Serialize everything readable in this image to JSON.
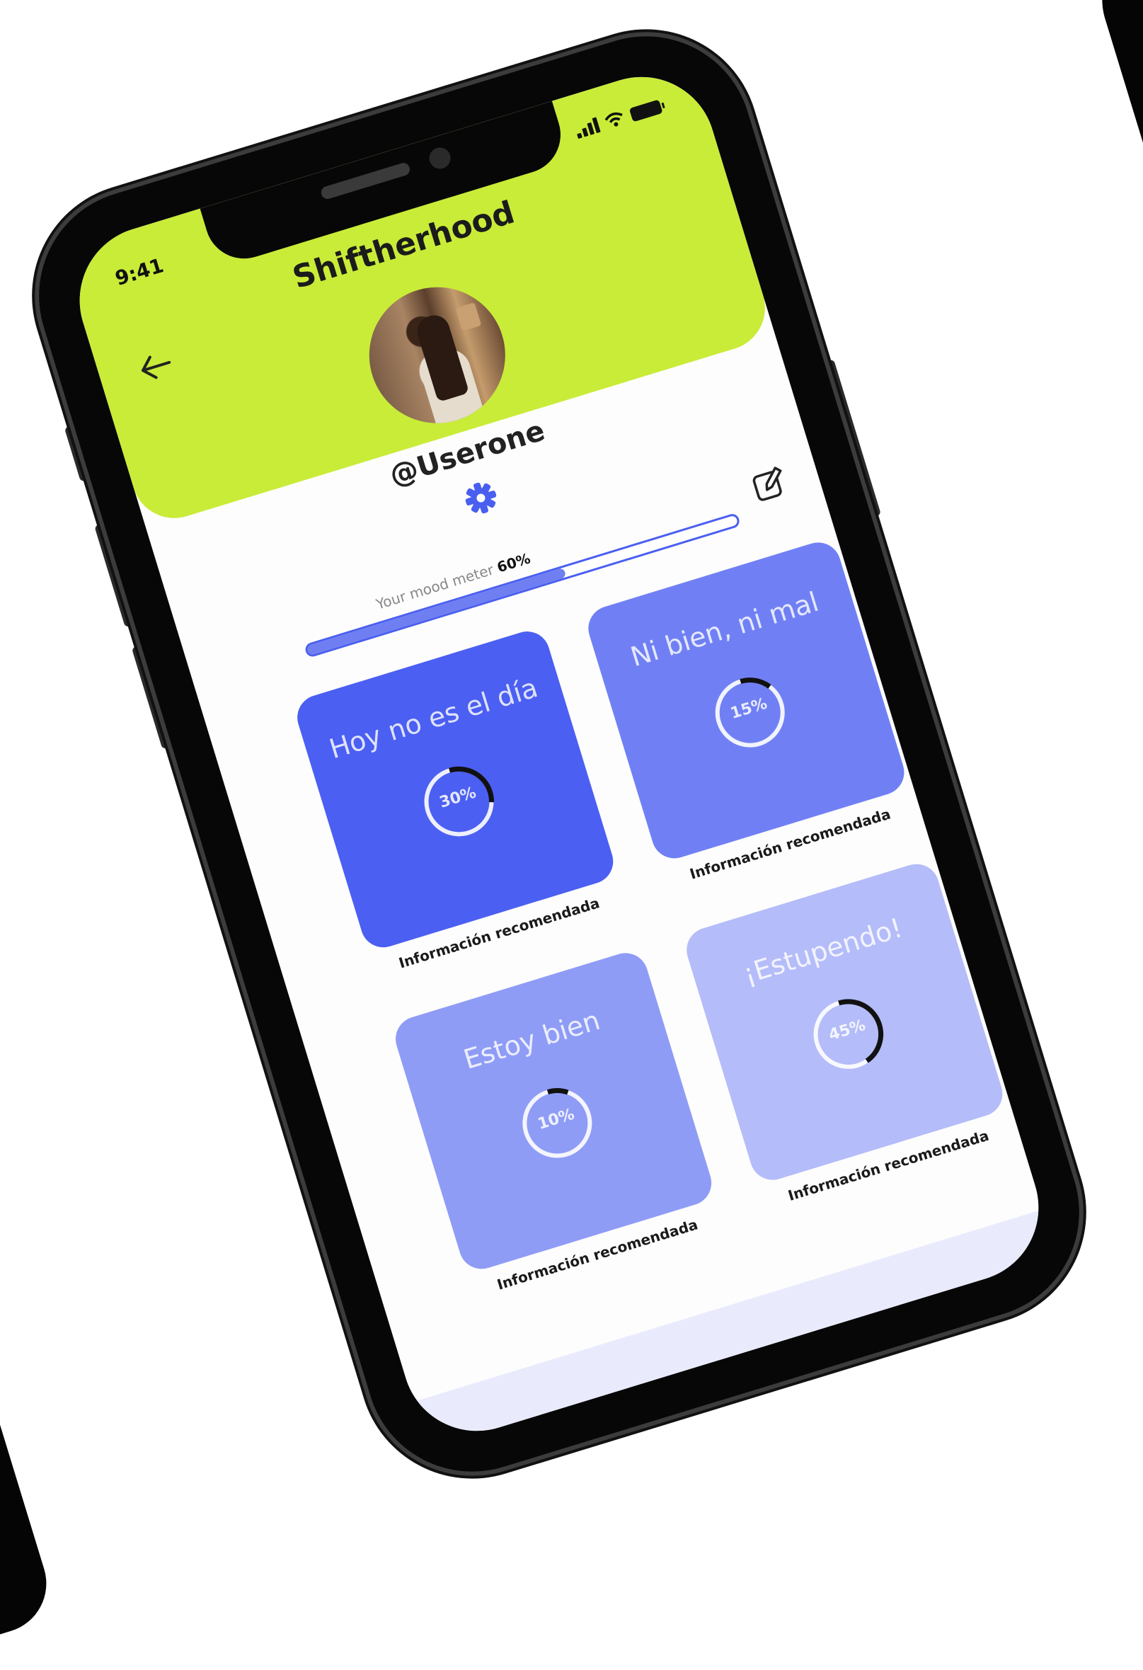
{
  "status_bar": {
    "time": "9:41"
  },
  "header": {
    "title": "Shiftherhood"
  },
  "profile": {
    "username": "@Userone"
  },
  "mood_meter": {
    "label": "Your mood meter",
    "value_text": "60%",
    "value": 0.6
  },
  "cards": [
    {
      "title": "Hoy no es el día",
      "percent_text": "30%",
      "percent": 30,
      "link": "Información recomendada",
      "color": "#4b5ff2"
    },
    {
      "title": "Ni bien, ni mal",
      "percent_text": "15%",
      "percent": 15,
      "link": "Información recomendada",
      "color": "#7080f4"
    },
    {
      "title": "Estoy bien",
      "percent_text": "10%",
      "percent": 10,
      "link": "Información recomendada",
      "color": "#8f9cf6"
    },
    {
      "title": "¡Estupendo!",
      "percent_text": "45%",
      "percent": 45,
      "link": "Información recomendada",
      "color": "#b4bcf9"
    }
  ],
  "colors": {
    "header": "#c9ec38",
    "accent": "#4a5ff0"
  },
  "icons": {
    "back": "arrow-left-icon",
    "settings": "gear-icon",
    "edit": "edit-icon"
  }
}
